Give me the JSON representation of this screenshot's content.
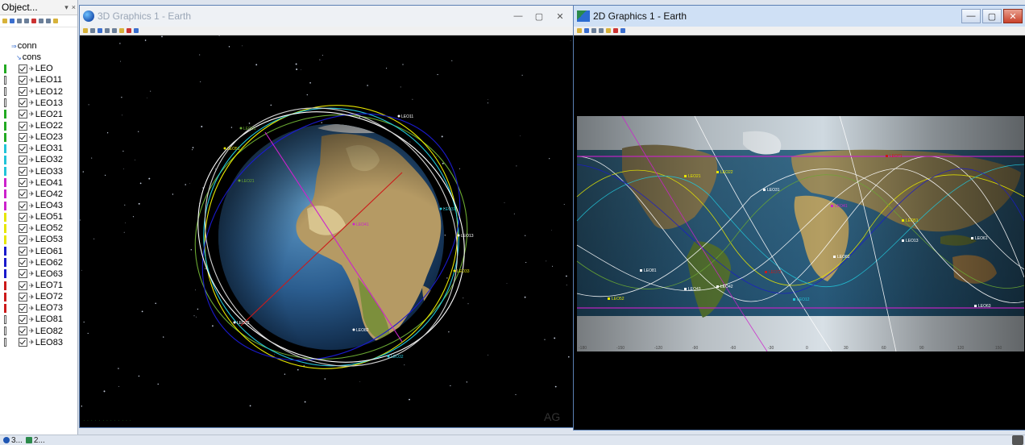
{
  "object_browser": {
    "title": "Object...",
    "items": [
      {
        "label": "conn",
        "type": "top"
      },
      {
        "label": "cons",
        "type": "top2"
      },
      {
        "label": "LEO",
        "color": "#22aa22",
        "hollow": false
      },
      {
        "label": "LEO11",
        "color": "#ffffff",
        "hollow": true
      },
      {
        "label": "LEO12",
        "color": "#ffffff",
        "hollow": true
      },
      {
        "label": "LEO13",
        "color": "#ffffff",
        "hollow": true
      },
      {
        "label": "LEO21",
        "color": "#22aa22",
        "hollow": false
      },
      {
        "label": "LEO22",
        "color": "#22aa22",
        "hollow": false
      },
      {
        "label": "LEO23",
        "color": "#22aa22",
        "hollow": false
      },
      {
        "label": "LEO31",
        "color": "#22c4d8",
        "hollow": false
      },
      {
        "label": "LEO32",
        "color": "#22c4d8",
        "hollow": false
      },
      {
        "label": "LEO33",
        "color": "#22c4d8",
        "hollow": false
      },
      {
        "label": "LEO41",
        "color": "#cc22cc",
        "hollow": false
      },
      {
        "label": "LEO42",
        "color": "#cc22cc",
        "hollow": false
      },
      {
        "label": "LEO43",
        "color": "#cc22cc",
        "hollow": false
      },
      {
        "label": "LEO51",
        "color": "#e6e600",
        "hollow": false
      },
      {
        "label": "LEO52",
        "color": "#e6e600",
        "hollow": false
      },
      {
        "label": "LEO53",
        "color": "#e6e600",
        "hollow": false
      },
      {
        "label": "LEO61",
        "color": "#1a1acc",
        "hollow": false
      },
      {
        "label": "LEO62",
        "color": "#1a1acc",
        "hollow": false
      },
      {
        "label": "LEO63",
        "color": "#1a1acc",
        "hollow": false
      },
      {
        "label": "LEO71",
        "color": "#cc1a1a",
        "hollow": false
      },
      {
        "label": "LEO72",
        "color": "#cc1a1a",
        "hollow": false
      },
      {
        "label": "LEO73",
        "color": "#cc1a1a",
        "hollow": false
      },
      {
        "label": "LEO81",
        "color": "#ffffff",
        "hollow": true
      },
      {
        "label": "LEO82",
        "color": "#ffffff",
        "hollow": true
      },
      {
        "label": "LEO83",
        "color": "#ffffff",
        "hollow": true
      }
    ]
  },
  "window3d": {
    "title": "3D Graphics 1 - Earth",
    "sat_labels": [
      "LEO41",
      "LEO51",
      "LEO21",
      "LEO31",
      "LEO11",
      "LEO12",
      "LEO82",
      "LEO33",
      "LEO13",
      "LEO32",
      "LEO61"
    ],
    "watermark": "AG"
  },
  "window2d": {
    "title": "2D Graphics 1 - Earth",
    "sat_labels": [
      "LEO71",
      "LEO21",
      "LEO31",
      "LEO41",
      "LEO51",
      "LEO61",
      "LEO13",
      "LEO22",
      "LEO82",
      "LEO81",
      "LEO52",
      "LEO72",
      "LEO42",
      "LEO43",
      "LEO12",
      "LEO63"
    ],
    "lon_ticks": [
      "-180",
      "-150",
      "-120",
      "-90",
      "-60",
      "-30",
      "0",
      "30",
      "60",
      "90",
      "120",
      "150"
    ]
  },
  "taskbar": {
    "items": [
      "3...",
      "2..."
    ]
  }
}
